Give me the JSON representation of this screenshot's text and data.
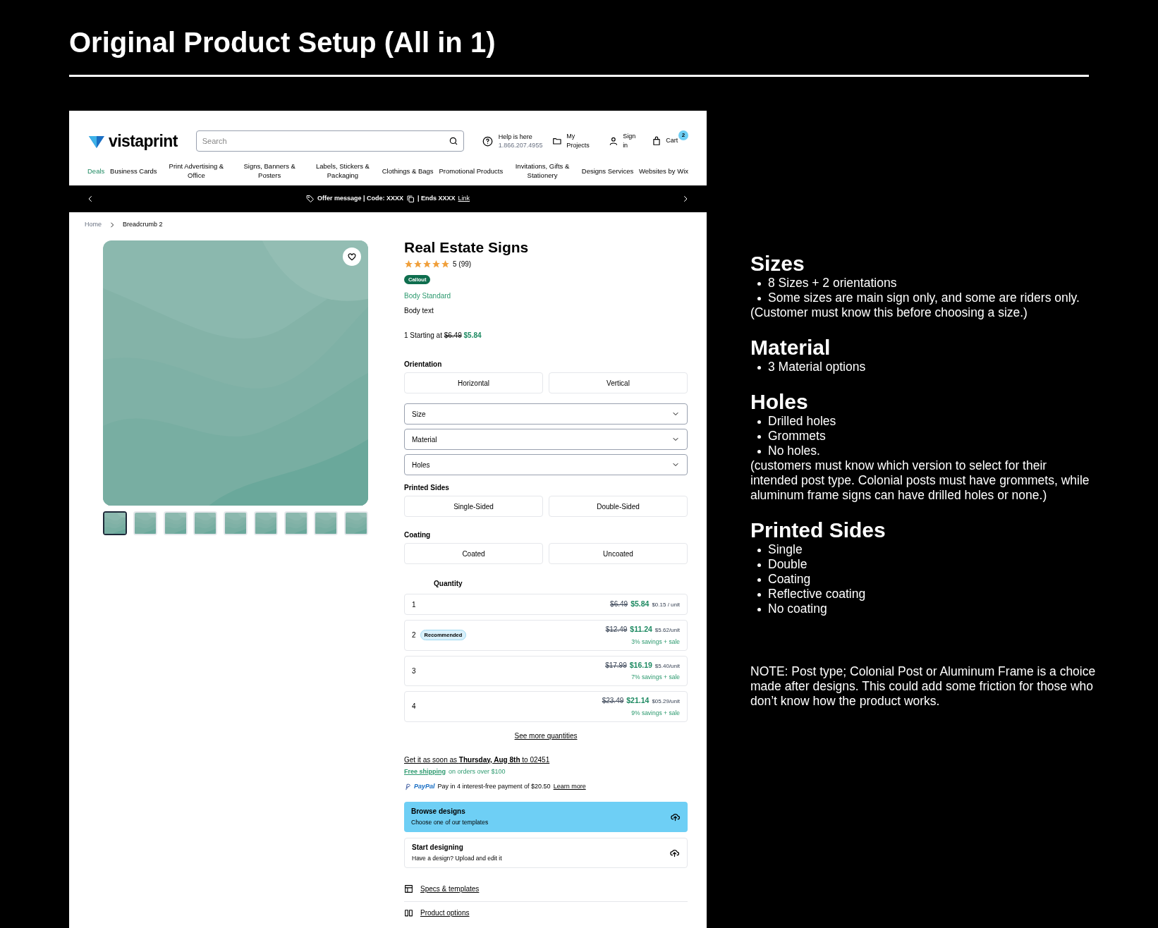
{
  "board_title": "Original Product Setup (All in 1)",
  "header": {
    "logo": "vistaprint",
    "search": {
      "placeholder": "Search"
    },
    "help": {
      "title": "Help is here",
      "phone": "1.866.207.4955"
    },
    "links": [
      {
        "kind": "folder",
        "label": "My Projects"
      },
      {
        "kind": "person",
        "label": "Sign in"
      },
      {
        "kind": "bag",
        "label": "Cart",
        "badge": "2"
      }
    ]
  },
  "nav": [
    {
      "label": "Deals",
      "selected": true
    },
    {
      "label": "Business Cards",
      "selected": false
    },
    {
      "label": "Print Advertising & Office",
      "selected": false
    },
    {
      "label": "Signs, Banners & Posters",
      "selected": false
    },
    {
      "label": "Labels, Stickers & Packaging",
      "selected": false
    },
    {
      "label": "Clothings & Bags",
      "selected": false
    },
    {
      "label": "Promotional Products",
      "selected": false
    },
    {
      "label": "Invitations, Gifts & Stationery",
      "selected": false
    },
    {
      "label": "Designs Services",
      "selected": false
    },
    {
      "label": "Websites by Wix",
      "selected": false
    }
  ],
  "offer_bar": {
    "message": "Offer message | Code: XXXX",
    "ends": "| Ends XXXX",
    "link": "Link"
  },
  "breadcrumb": [
    "Home",
    "Breadcrumb 2"
  ],
  "gallery": {
    "thumbnails": [
      {
        "selected": true
      },
      {
        "selected": false
      },
      {
        "selected": false
      },
      {
        "selected": false
      },
      {
        "selected": false
      },
      {
        "selected": false
      },
      {
        "selected": false
      },
      {
        "selected": false
      },
      {
        "selected": false
      }
    ]
  },
  "product": {
    "title": "Real Estate Signs",
    "stars": 5,
    "rating": "5 (99)",
    "callout": "Callout",
    "body_standard": "Body Standard",
    "body_text": "Body text",
    "price_prefix": "1 Starting at",
    "price_was": "$6.49",
    "price_now": "$5.84"
  },
  "options": [
    {
      "kind": "toggle",
      "label": "Orientation",
      "choices": [
        {
          "label": "Horizontal",
          "selected": false
        },
        {
          "label": "Vertical",
          "selected": false
        }
      ]
    },
    {
      "kind": "dropdown",
      "label": "Size"
    },
    {
      "kind": "dropdown",
      "label": "Material"
    },
    {
      "kind": "dropdown",
      "label": "Holes"
    },
    {
      "kind": "toggle",
      "label": "Printed Sides",
      "choices": [
        {
          "label": "Single-Sided",
          "selected": false
        },
        {
          "label": "Double-Sided",
          "selected": false
        }
      ]
    },
    {
      "kind": "toggle",
      "label": "Coating",
      "choices": [
        {
          "label": "Coated",
          "selected": false
        },
        {
          "label": "Uncoated",
          "selected": false
        }
      ]
    }
  ],
  "quantity": {
    "label": "Quantity",
    "rows": [
      {
        "qty": "1",
        "was": "$6.49",
        "now": "$5.84",
        "unit": "$0.15 / unit"
      },
      {
        "qty": "2",
        "badge": "Recommended",
        "was": "$12.49",
        "now": "$11.24",
        "unit": "$5.62/unit",
        "savings": "3% savings + sale"
      },
      {
        "qty": "3",
        "was": "$17.99",
        "now": "$16.19",
        "unit": "$5.40/unit",
        "savings": "7% savings + sale"
      },
      {
        "qty": "4",
        "was": "$23.49",
        "now": "$21.14",
        "unit": "$05.29/unit",
        "savings": "9% savings + sale"
      }
    ],
    "more": "See more quantities"
  },
  "delivery": {
    "text": "Get it as soon as **Thursday, Aug 8th** to 02451",
    "free_link": "Free shipping",
    "free_text": "on orders over $100",
    "paypal": "PayPal",
    "paypal_text": "Pay in 4 interest-free payment of $20.50",
    "learn_more": "Learn more"
  },
  "design_cards": [
    {
      "title": "Browse designs",
      "subtitle": "Choose one of our templates",
      "selected": true
    },
    {
      "title": "Start designing",
      "subtitle": "Have a design? Upload and edit it",
      "selected": false
    }
  ],
  "links": [
    {
      "kind": "table",
      "label": "Specs & templates"
    },
    {
      "kind": "book",
      "label": "Product options"
    }
  ],
  "notes": [
    {
      "heading": "Sizes",
      "bullets": [
        "8 Sizes + 2 orientations",
        "Some sizes are main sign only, and some are riders only."
      ],
      "note": "(Customer must know this before choosing a size.)"
    },
    {
      "heading": "Material",
      "bullets": [
        "3 Material options"
      ]
    },
    {
      "heading": "Holes",
      "bullets": [
        "Drilled holes",
        "Grommets",
        "No holes."
      ],
      "note": "(customers must know which version to select for their intended post type. Colonial posts must have grommets, while aluminum frame signs can have drilled holes or none.)"
    },
    {
      "heading": "Printed Sides",
      "bullets": [
        "Single",
        "Double",
        "Coating",
        "Reflective coating",
        "No coating"
      ]
    }
  ],
  "final_note": "NOTE: Post type; Colonial Post or Aluminum Frame is a choice made after designs. This could add some friction for those who don’t know how the product works."
}
